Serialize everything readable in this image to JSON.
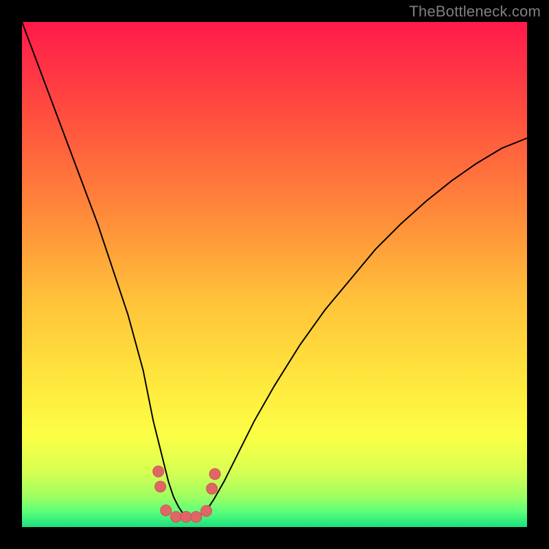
{
  "watermark": "TheBottleneck.com",
  "colors": {
    "frame": "#000000",
    "curve": "#000000",
    "markers_fill": "#e06666",
    "markers_stroke": "#cc5555",
    "gradient_stops": [
      {
        "offset": "0%",
        "color": "#ff1a4b"
      },
      {
        "offset": "18%",
        "color": "#ff4d3f"
      },
      {
        "offset": "38%",
        "color": "#ff8a3a"
      },
      {
        "offset": "55%",
        "color": "#ffc23a"
      },
      {
        "offset": "72%",
        "color": "#ffe93e"
      },
      {
        "offset": "82%",
        "color": "#fbff45"
      },
      {
        "offset": "89%",
        "color": "#d8ff52"
      },
      {
        "offset": "94%",
        "color": "#9eff62"
      },
      {
        "offset": "97%",
        "color": "#5cff7a"
      },
      {
        "offset": "100%",
        "color": "#18e07e"
      }
    ]
  },
  "chart_data": {
    "type": "line",
    "title": "",
    "xlabel": "",
    "ylabel": "",
    "xlim": [
      0,
      100
    ],
    "ylim": [
      0,
      100
    ],
    "grid": false,
    "series": [
      {
        "name": "bottleneck-curve",
        "x": [
          0,
          3,
          6,
          9,
          12,
          15,
          18,
          21,
          24,
          26,
          27,
          28,
          29,
          30,
          31,
          32,
          33,
          34,
          35,
          36,
          37,
          38,
          40,
          43,
          46,
          50,
          55,
          60,
          65,
          70,
          75,
          80,
          85,
          90,
          95,
          100
        ],
        "y": [
          100,
          92,
          84,
          76,
          68,
          60,
          51,
          42,
          31,
          21,
          17,
          13,
          9,
          6,
          4,
          2.5,
          2,
          2,
          2.3,
          3,
          4,
          5.5,
          9,
          15,
          21,
          28,
          36,
          43,
          49,
          55,
          60,
          64.5,
          68.5,
          72,
          75,
          77
        ],
        "color": "#000000"
      }
    ],
    "markers": {
      "name": "highlight-points",
      "points": [
        {
          "x": 27.0,
          "y": 11.0
        },
        {
          "x": 27.4,
          "y": 8.0
        },
        {
          "x": 28.5,
          "y": 3.3
        },
        {
          "x": 30.5,
          "y": 2.0
        },
        {
          "x": 32.5,
          "y": 2.0
        },
        {
          "x": 34.5,
          "y": 2.0
        },
        {
          "x": 36.5,
          "y": 3.2
        },
        {
          "x": 37.6,
          "y": 7.6
        },
        {
          "x": 38.2,
          "y": 10.5
        }
      ],
      "radius_px": 8,
      "fill": "#e06666",
      "stroke": "#cc5555"
    }
  }
}
